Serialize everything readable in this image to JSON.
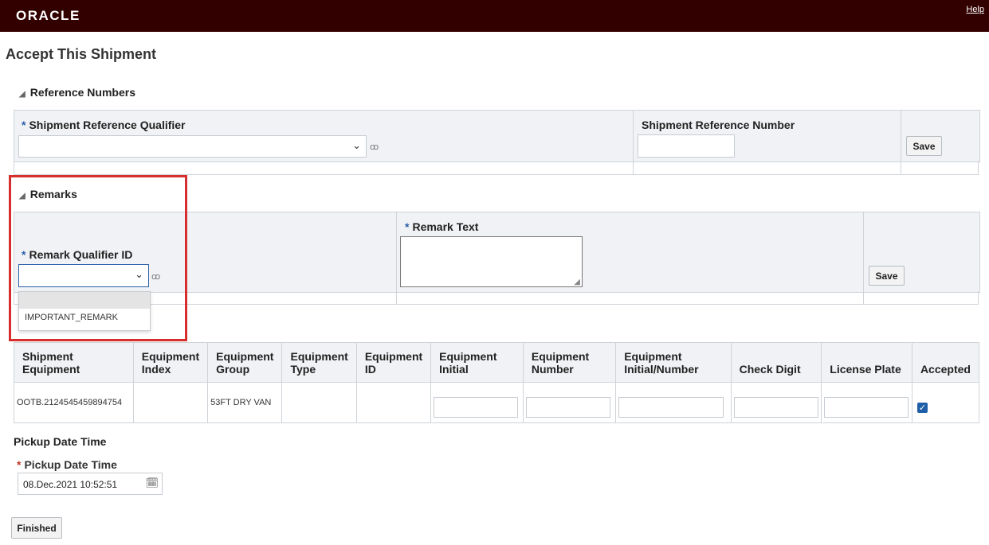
{
  "header": {
    "logo": "ORACLE",
    "help": "Help"
  },
  "page_title": "Accept This Shipment",
  "reference_numbers": {
    "title": "Reference Numbers",
    "qualifier_label": "Shipment Reference Qualifier",
    "number_label": "Shipment Reference Number",
    "save_label": "Save"
  },
  "remarks": {
    "title": "Remarks",
    "qualifier_label": "Remark Qualifier ID",
    "text_label": "Remark Text",
    "save_label": "Save",
    "dropdown_options": [
      "",
      "IMPORTANT_REMARK"
    ]
  },
  "equipment": {
    "columns": [
      "Shipment Equipment",
      "Equipment Index",
      "Equipment Group",
      "Equipment Type",
      "Equipment ID",
      "Equipment Initial",
      "Equipment Number",
      "Equipment Initial/Number",
      "Check Digit",
      "License Plate",
      "Accepted"
    ],
    "row": {
      "shipment_equipment": "OOTB.2124545459894754",
      "equipment_index": "",
      "equipment_group": "53FT DRY VAN",
      "equipment_type": "",
      "equipment_id": "",
      "accepted": true
    }
  },
  "pickup": {
    "section_title": "Pickup Date Time",
    "label": "Pickup Date Time",
    "value": "08.Dec.2021 10:52:51"
  },
  "finished_label": "Finished",
  "colors": {
    "topbar": "#330000",
    "required": "#2b5ea8",
    "highlight": "#d62d2d",
    "checkbox": "#1f5fa8"
  }
}
